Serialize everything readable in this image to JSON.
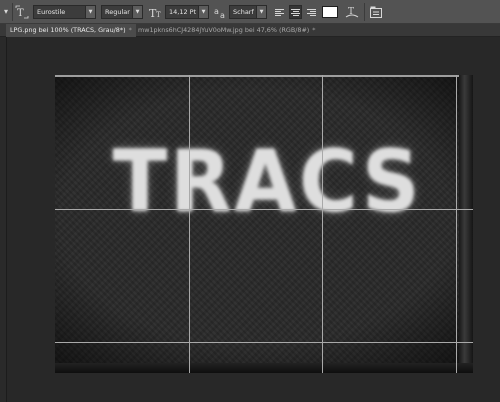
{
  "options_bar": {
    "tool_icon": "type-tool-icon",
    "orientation_icon": "text-orientation-icon",
    "font_family": "Eurostile",
    "font_style": "Regular",
    "font_size_icon": "font-size-icon",
    "font_size": "14,12 Pt",
    "antialias_icon": "antialias-icon",
    "antialias": "Scharf",
    "align_left_icon": "align-left-icon",
    "align_center_icon": "align-center-icon",
    "align_right_icon": "align-right-icon",
    "text_color": "#ffffff",
    "warp_icon": "warp-text-icon",
    "panels_icon": "character-panel-icon"
  },
  "tabs": [
    {
      "label": "LPG.png bei 100% (TRACS, Grau/8*)",
      "close": "*",
      "active": true
    },
    {
      "label": "mw1pkns6hCJ4284jYuV0oMw.jpg bei 47,6% (RGB/8#)",
      "close": "*",
      "active": false
    }
  ],
  "document": {
    "text_layer": "TRACS"
  }
}
